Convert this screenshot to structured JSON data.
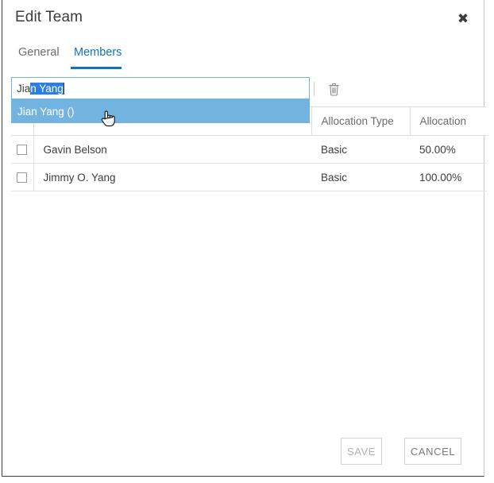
{
  "dialog": {
    "title": "Edit Team",
    "close_icon": "close-icon",
    "close_label": "✖"
  },
  "tabs": [
    {
      "label": "General",
      "active": false
    },
    {
      "label": "Members",
      "active": true
    }
  ],
  "member_search": {
    "typed_text": "Jia",
    "suggested_completion": "n Yang",
    "full_value": "Jian Yang",
    "placeholder": "",
    "options": [
      {
        "label": "Jian Yang ()",
        "highlighted": true
      }
    ]
  },
  "toolbar": {
    "delete_icon": "trash-icon",
    "delete_label": "Delete"
  },
  "table": {
    "columns": [
      "",
      "",
      "Allocation Type",
      "Allocation"
    ],
    "rows": [
      {
        "checked": false,
        "name": "Gavin Belson",
        "allocation_type": "Basic",
        "allocation": "50.00%"
      },
      {
        "checked": false,
        "name": "Jimmy O. Yang",
        "allocation_type": "Basic",
        "allocation": "100.00%"
      }
    ]
  },
  "footer": {
    "save_label": "SAVE",
    "cancel_label": "CANCEL"
  },
  "colors": {
    "accent": "#1473b8",
    "selection": "#2a7fe0",
    "option_highlight": "#72b3e0",
    "text": "#3c3c3c",
    "muted_text": "#6b6b6b",
    "border": "#dcdcdc"
  }
}
